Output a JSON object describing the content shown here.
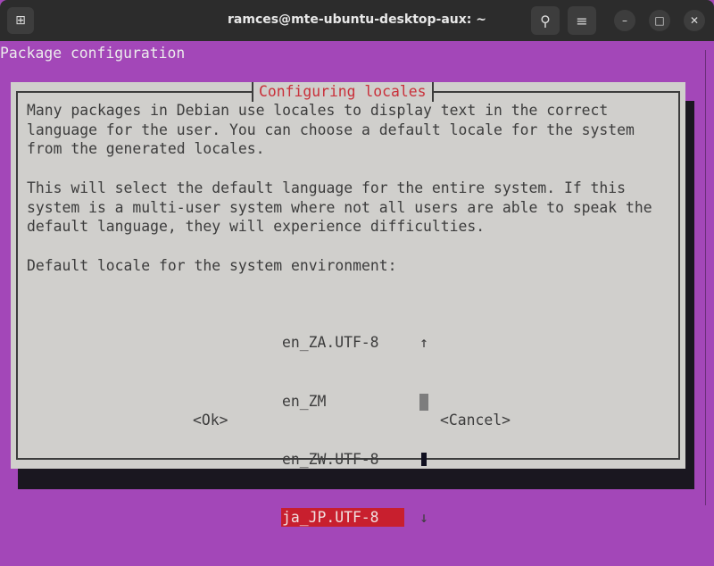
{
  "window": {
    "title": "ramces@mte-ubuntu-desktop-aux: ~"
  },
  "terminal": {
    "header": "Package configuration",
    "dialog": {
      "title": "Configuring locales",
      "body": "Many packages in Debian use locales to display text in the correct\nlanguage for the user. You can choose a default locale for the system\nfrom the generated locales.\n\nThis will select the default language for the entire system. If this\nsystem is a multi-user system where not all users are able to speak the\ndefault language, they will experience difficulties.\n\nDefault locale for the system environment:",
      "options": [
        "en_ZA.UTF-8",
        "en_ZM",
        "en_ZW.UTF-8",
        "ja_JP.UTF-8"
      ],
      "selected": "ja_JP.UTF-8",
      "scroll_up": "↑",
      "scroll_down": "↓",
      "ok": "<Ok>",
      "cancel": "<Cancel>"
    }
  }
}
